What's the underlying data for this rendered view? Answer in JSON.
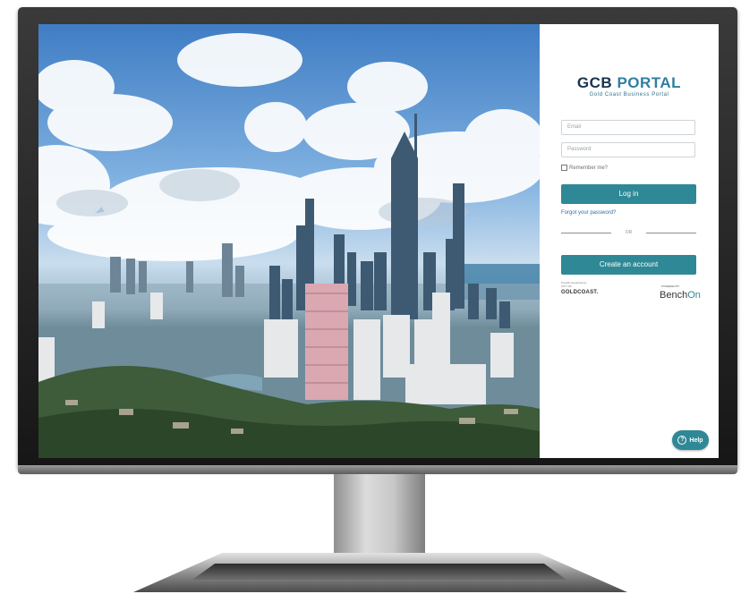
{
  "brand": {
    "name_part1": "GCB",
    "name_part2": "PORTAL",
    "subtitle": "Gold Coast Business Portal"
  },
  "login": {
    "email_placeholder": "Email",
    "password_placeholder": "Password",
    "remember_label": "Remember me?",
    "login_label": "Log in",
    "forgot_label": "Forgot your password?",
    "or_label": "OR",
    "create_label": "Create an account"
  },
  "footer": {
    "gc_small": "Proudly supported by",
    "gc_city": "CITY OF",
    "gc_name": "GOLDCOAST.",
    "powered_label": "POWERED BY",
    "bench_part1": "Bench",
    "bench_part2": "On"
  },
  "help": {
    "label": "Help",
    "icon": "?"
  },
  "colors": {
    "accent": "#2f8896",
    "brand_dark": "#17344f",
    "brand_light": "#2e7fa0"
  }
}
